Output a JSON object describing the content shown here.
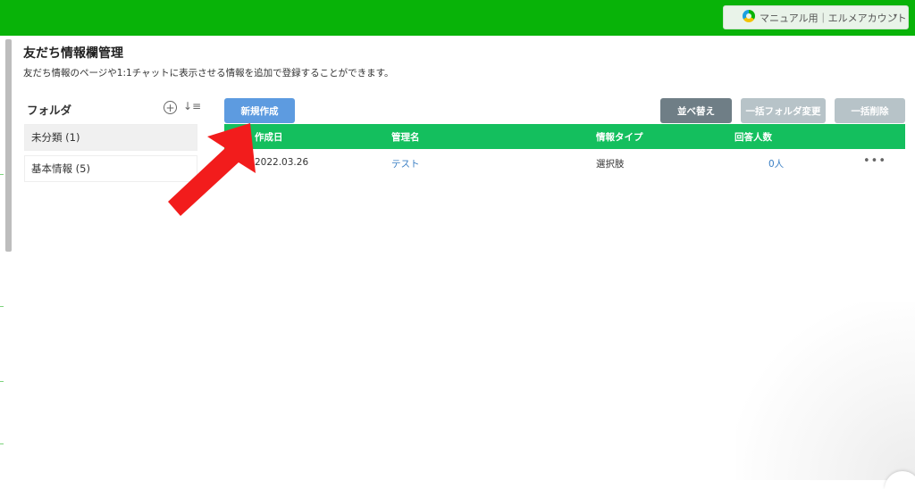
{
  "header": {
    "account_label": "マニュアル用｜エルメアカウント",
    "account_caret": "▾"
  },
  "page": {
    "title": "友だち情報欄管理",
    "description": "友だち情報のページや1:1チャットに表示させる情報を追加で登録することができます。"
  },
  "sidebar": {
    "title": "フォルダ",
    "add_icon": "⊕",
    "sort_icon": "↓≡",
    "folders": [
      {
        "label": "未分類 (1)"
      },
      {
        "label": "基本情報 (5)"
      }
    ]
  },
  "toolbar": {
    "new_label": "新規作成",
    "sort_label": "並べ替え",
    "bulk_folder_label": "一括フォルダ変更",
    "bulk_delete_label": "一括削除"
  },
  "table": {
    "headers": [
      "作成日",
      "管理名",
      "情報タイプ",
      "回答人数"
    ],
    "rows": [
      {
        "created": "2022.03.26",
        "name": "テスト",
        "type": "選択肢",
        "count": "0人",
        "more": "•••"
      }
    ]
  },
  "colors": {
    "topbar": "#08b308",
    "table_header": "#14bf5e",
    "primary_button": "#5d9be0",
    "arrow": "#f21c1c"
  }
}
